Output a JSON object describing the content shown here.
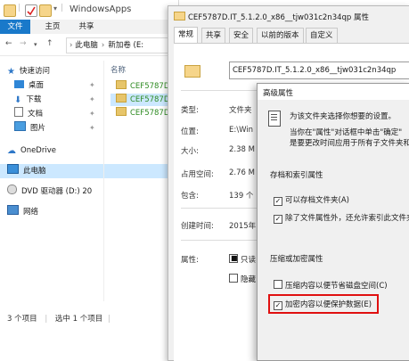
{
  "explorer": {
    "window_title": "WindowsApps",
    "ribbon_tabs": [
      "文件",
      "主页",
      "共享"
    ],
    "address_path": [
      "此电脑",
      "新加卷 (E:"
    ],
    "column_header": "名称",
    "tree": [
      {
        "label": "快速访问",
        "icon": "star-icon",
        "pinned": false
      },
      {
        "label": "桌面",
        "icon": "desktop-icon",
        "pinned": true
      },
      {
        "label": "下载",
        "icon": "download-icon",
        "pinned": true
      },
      {
        "label": "文档",
        "icon": "document-icon",
        "pinned": true
      },
      {
        "label": "图片",
        "icon": "pictures-icon",
        "pinned": true
      },
      {
        "label": "OneDrive",
        "icon": "cloud-icon",
        "pinned": false
      },
      {
        "label": "此电脑",
        "icon": "computer-icon",
        "pinned": false
      },
      {
        "label": "DVD 驱动器 (D:) 20",
        "icon": "dvd-icon",
        "pinned": false
      },
      {
        "label": "网络",
        "icon": "network-icon",
        "pinned": false
      }
    ],
    "files": [
      "CEF5787D.I",
      "CEF5787D.I",
      "CEF5787D.I"
    ],
    "status": {
      "count": "3 个项目",
      "selected": "选中 1 个项目"
    }
  },
  "properties": {
    "title": "CEF5787D.IT_5.1.2.0_x86__tjw031c2n34qp 属性",
    "tabs": [
      "常规",
      "共享",
      "安全",
      "以前的版本",
      "自定义"
    ],
    "name_value": "CEF5787D.IT_5.1.2.0_x86__tjw031c2n34qp",
    "rows": [
      {
        "label": "类型:",
        "value": "文件夹"
      },
      {
        "label": "位置:",
        "value": "E:\\Win"
      },
      {
        "label": "大小:",
        "value": "2.38 M"
      },
      {
        "label": "占用空间:",
        "value": "2.76 M"
      },
      {
        "label": "包含:",
        "value": "139 个"
      },
      {
        "label": "创建时间:",
        "value": "2015年"
      },
      {
        "label": "属性:",
        "value": ""
      }
    ],
    "attr_readonly": "只读",
    "attr_hidden": "隐藏"
  },
  "advanced": {
    "title": "高级属性",
    "intro": "为该文件夹选择你想要的设置。",
    "intro2": "当你在\"属性\"对话框中单击\"确定\"",
    "intro3": "是要更改时间应用于所有子文件夹和",
    "group1": "存档和索引属性",
    "opt_archive": "可以存档文件夹(A)",
    "opt_index": "除了文件属性外，还允许索引此文件夹",
    "group2": "压缩或加密属性",
    "opt_compress": "压缩内容以便节省磁盘空间(C)",
    "opt_encrypt": "加密内容以便保护数据(E)",
    "colors": {
      "highlight": "#e01010",
      "selection": "#cce8ff",
      "accent": "#1979ca"
    }
  }
}
